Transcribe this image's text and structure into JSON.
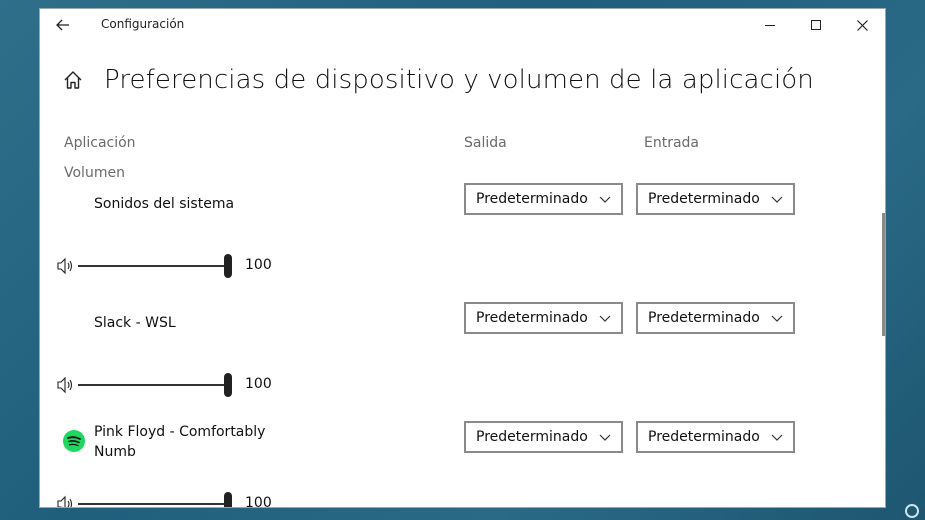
{
  "window": {
    "title": "Configuración",
    "back_icon": "back-arrow-icon",
    "minimize_icon": "minimize-icon",
    "maximize_icon": "maximize-icon",
    "close_icon": "close-icon"
  },
  "page": {
    "home_icon": "home-icon",
    "title": "Preferencias de dispositivo y volumen de la aplicación"
  },
  "columns": {
    "app": "Aplicación",
    "output": "Salida",
    "input": "Entrada",
    "volume": "Volumen"
  },
  "apps": [
    {
      "name": "Sonidos del sistema",
      "icon": "",
      "output": "Predeterminado",
      "input": "Predeterminado",
      "volume": "100",
      "volume_level": 100
    },
    {
      "name": "Slack - WSL",
      "icon": "",
      "output": "Predeterminado",
      "input": "Predeterminado",
      "volume": "100",
      "volume_level": 100
    },
    {
      "name": "Pink Floyd - Comfortably Numb",
      "icon": "spotify-icon",
      "output": "Predeterminado",
      "input": "Predeterminado",
      "volume": "100",
      "volume_level": 100
    }
  ],
  "colors": {
    "spotify_green": "#1ed760",
    "accent_dark": "#222222",
    "muted_text": "#6b6b6b"
  }
}
